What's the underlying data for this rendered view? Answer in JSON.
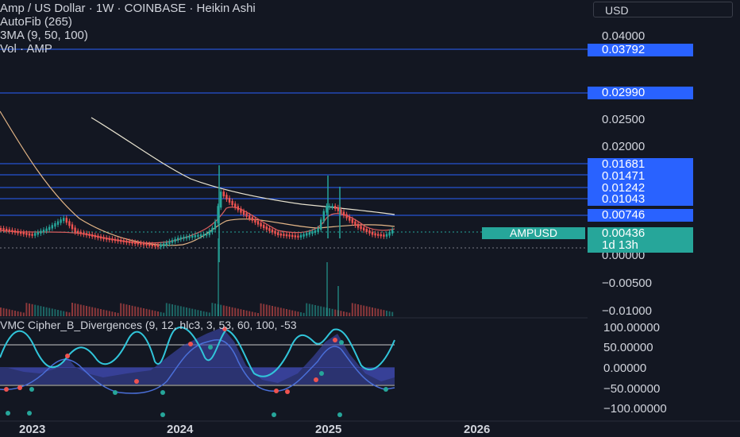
{
  "header": {
    "title": "Amp / US Dollar · 1W · COINBASE · Heikin Ashi",
    "ind1": "AutoFib (265)",
    "ind2": "3MA (9, 50, 100)",
    "ind3": "Vol · AMP"
  },
  "currency_button": "USD",
  "indicator_label": "VMC Cipher_B_Divergences (9, 12, hlc3, 3, 53, 60, 100, -53",
  "price_axis": {
    "ticks": [
      "0.04000",
      "0.02500",
      "0.02000",
      "0.00000",
      "−0.00500",
      "−0.01000"
    ],
    "fib_labels": [
      "0.03792",
      "0.02990",
      "0.01681",
      "0.01471",
      "0.01242",
      "0.01043",
      "0.00746"
    ],
    "symbol": "AMPUSD",
    "last_price": "0.00436",
    "countdown": "1d 13h"
  },
  "osc_axis": [
    "100.00000",
    "50.00000",
    "0.00000",
    "−50.00000",
    "−100.00000"
  ],
  "time_axis": [
    "2023",
    "2024",
    "2025",
    "2026"
  ],
  "colors": {
    "background": "#131722",
    "up": "#26a69a",
    "down": "#ef5350",
    "fib_line": "#2962ff",
    "price_label": "#2962ff",
    "wave": "#31c5da",
    "symbol_tag": "#26a69a"
  }
}
